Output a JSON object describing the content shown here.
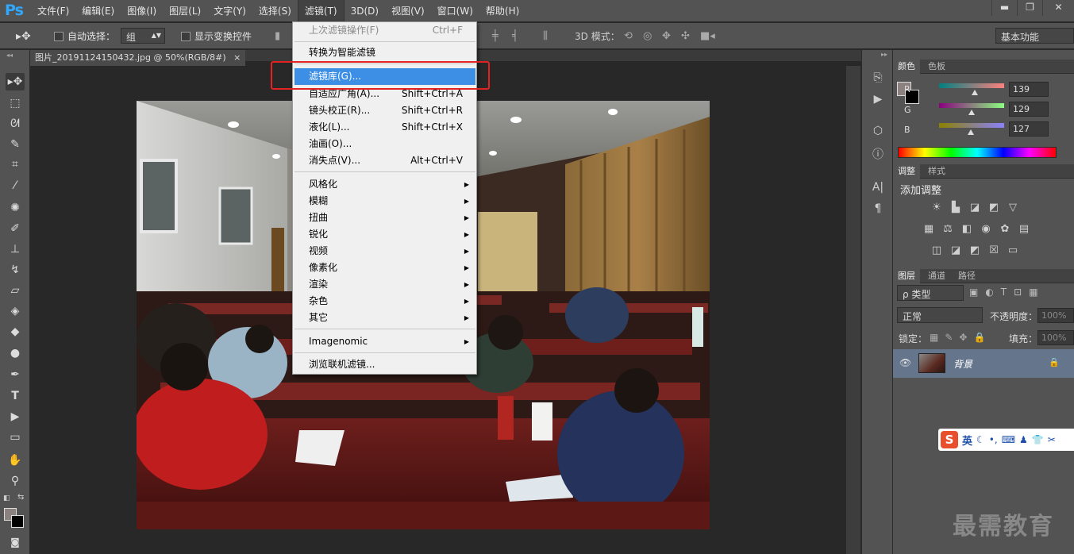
{
  "app": {
    "logo": "Ps"
  },
  "menubar": {
    "items": [
      "文件(F)",
      "编辑(E)",
      "图像(I)",
      "图层(L)",
      "文字(Y)",
      "选择(S)",
      "滤镜(T)",
      "3D(D)",
      "视图(V)",
      "窗口(W)",
      "帮助(H)"
    ],
    "active": "滤镜(T)"
  },
  "window_controls": {
    "minimize": "▬",
    "restore": "❐",
    "close": "✕"
  },
  "options": {
    "auto_select_label": "自动选择：",
    "auto_select_value": "组",
    "show_transform_label": "显示变换控件",
    "mode3d_label": "3D 模式：",
    "workspace": "基本功能"
  },
  "document": {
    "tab_title": "图片_20191124150432.jpg @ 50%(RGB/8#)",
    "close": "×"
  },
  "filter_menu": {
    "last_filter": {
      "label": "上次滤镜操作(F)",
      "shortcut": "Ctrl+F"
    },
    "smart_filter": "转换为智能滤镜",
    "gallery": "滤镜库(G)...",
    "adaptive_wide": {
      "label": "自适应广角(A)...",
      "shortcut": "Shift+Ctrl+A"
    },
    "lens": {
      "label": "镜头校正(R)...",
      "shortcut": "Shift+Ctrl+R"
    },
    "liquify": {
      "label": "液化(L)...",
      "shortcut": "Shift+Ctrl+X"
    },
    "oil": "油画(O)...",
    "vanish": {
      "label": "消失点(V)...",
      "shortcut": "Alt+Ctrl+V"
    },
    "submenus": [
      "风格化",
      "模糊",
      "扭曲",
      "锐化",
      "视频",
      "像素化",
      "渲染",
      "杂色",
      "其它"
    ],
    "imagenomic": "Imagenomic",
    "browse": "浏览联机滤镜..."
  },
  "color_panel": {
    "tabs": [
      "颜色",
      "色板"
    ],
    "r_label": "R",
    "g_label": "G",
    "b_label": "B",
    "r": "139",
    "g": "129",
    "b": "127",
    "fg_color": "#8b817f"
  },
  "adjust_panel": {
    "tabs": [
      "调整",
      "样式"
    ],
    "title": "添加调整"
  },
  "layers_panel": {
    "tabs": [
      "图层",
      "通道",
      "路径"
    ],
    "kind": "ρ 类型",
    "blend": "正常",
    "opacity_label": "不透明度：",
    "opacity": "100%",
    "lock_label": "锁定：",
    "fill_label": "填充：",
    "fill": "100%",
    "layer_name": "背景"
  },
  "ime": {
    "logo": "S",
    "lang": "英"
  },
  "watermark": "最需教育"
}
